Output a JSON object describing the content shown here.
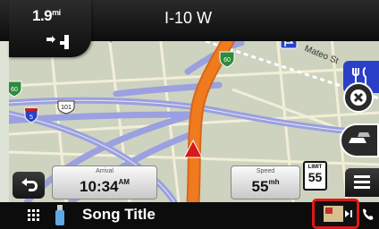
{
  "navigation": {
    "next_turn_distance": "1.9",
    "next_turn_distance_unit": "mi",
    "current_road": "I-10 W"
  },
  "map": {
    "street_label": "Mateo St",
    "route_shields": [
      "60",
      "60",
      "60",
      "5",
      "101"
    ],
    "colors": {
      "route": "#f07b1e",
      "freeway": "#9aa0e0",
      "background": "#cdd3bf"
    }
  },
  "trip": {
    "arrival_label": "Arrival",
    "arrival_time": "10:34",
    "arrival_suffix": "AM",
    "speed_label": "Speed",
    "speed_value": "55",
    "speed_unit": "mh",
    "speed_limit_label": "LIMIT",
    "speed_limit_value": "55"
  },
  "media": {
    "song_title": "Song Title"
  },
  "icons": [
    "back-icon",
    "menu-icon",
    "apps-grid-icon",
    "usb-icon",
    "media-player-icon",
    "phone-icon",
    "restaurant-poi-icon",
    "cancel-route-icon",
    "traffic-icon",
    "turn-right-icon",
    "vehicle-position-icon"
  ],
  "accent_colors": {
    "highlight": "#e01818",
    "poi": "#2b40c8"
  }
}
